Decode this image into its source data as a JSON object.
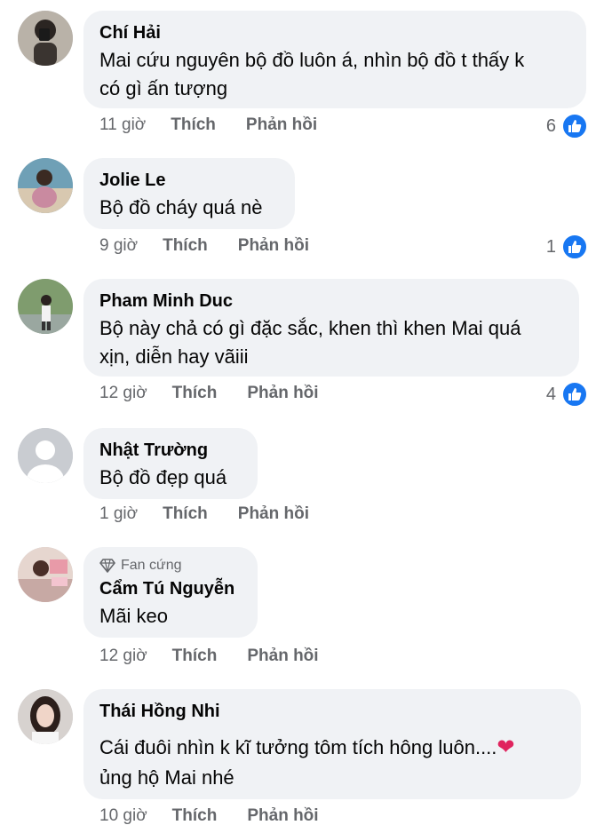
{
  "comments": [
    {
      "name": "Chí Hải",
      "badge": "",
      "lines": [
        "Mai cứu nguyên bộ đồ luôn á, nhìn bộ đồ t thấy k",
        "có gì ấn tượng"
      ],
      "time": "11 giờ",
      "like": "Thích",
      "reply": "Phản hồi",
      "reactions": "6"
    },
    {
      "name": "Jolie Le",
      "badge": "",
      "lines": [
        "Bộ đồ cháy quá nè"
      ],
      "time": "9 giờ",
      "like": "Thích",
      "reply": "Phản hồi",
      "reactions": "1"
    },
    {
      "name": "Pham Minh Duc",
      "badge": "",
      "lines": [
        "Bộ này chả có gì đặc sắc, khen thì khen Mai quá",
        "xịn, diễn hay vãiii"
      ],
      "time": "12 giờ",
      "like": "Thích",
      "reply": "Phản hồi",
      "reactions": "4"
    },
    {
      "name": "Nhật Trường",
      "badge": "",
      "lines": [
        "Bộ đồ đẹp quá"
      ],
      "time": "1 giờ",
      "like": "Thích",
      "reply": "Phản hồi",
      "reactions": ""
    },
    {
      "name": "Cẩm Tú Nguyễn",
      "badge": "Fan cứng",
      "lines": [
        "Mãi keo"
      ],
      "time": "12 giờ",
      "like": "Thích",
      "reply": "Phản hồi",
      "reactions": ""
    },
    {
      "name": "Thái Hồng Nhi",
      "badge": "",
      "lines": [
        "Cái đuôi nhìn k kĩ tưởng tôm tích hông luôn....",
        "ủng hộ Mai nhé"
      ],
      "time": "10 giờ",
      "like": "Thích",
      "reply": "Phản hồi",
      "reactions": ""
    }
  ],
  "icons": {
    "reaction": "like-thumb-icon",
    "badge": "diamond-icon",
    "emoji": "red-heart-icon"
  },
  "colors": {
    "bubble": "#f0f2f5",
    "like_blue": "#1877f2",
    "muted": "#65676b"
  }
}
